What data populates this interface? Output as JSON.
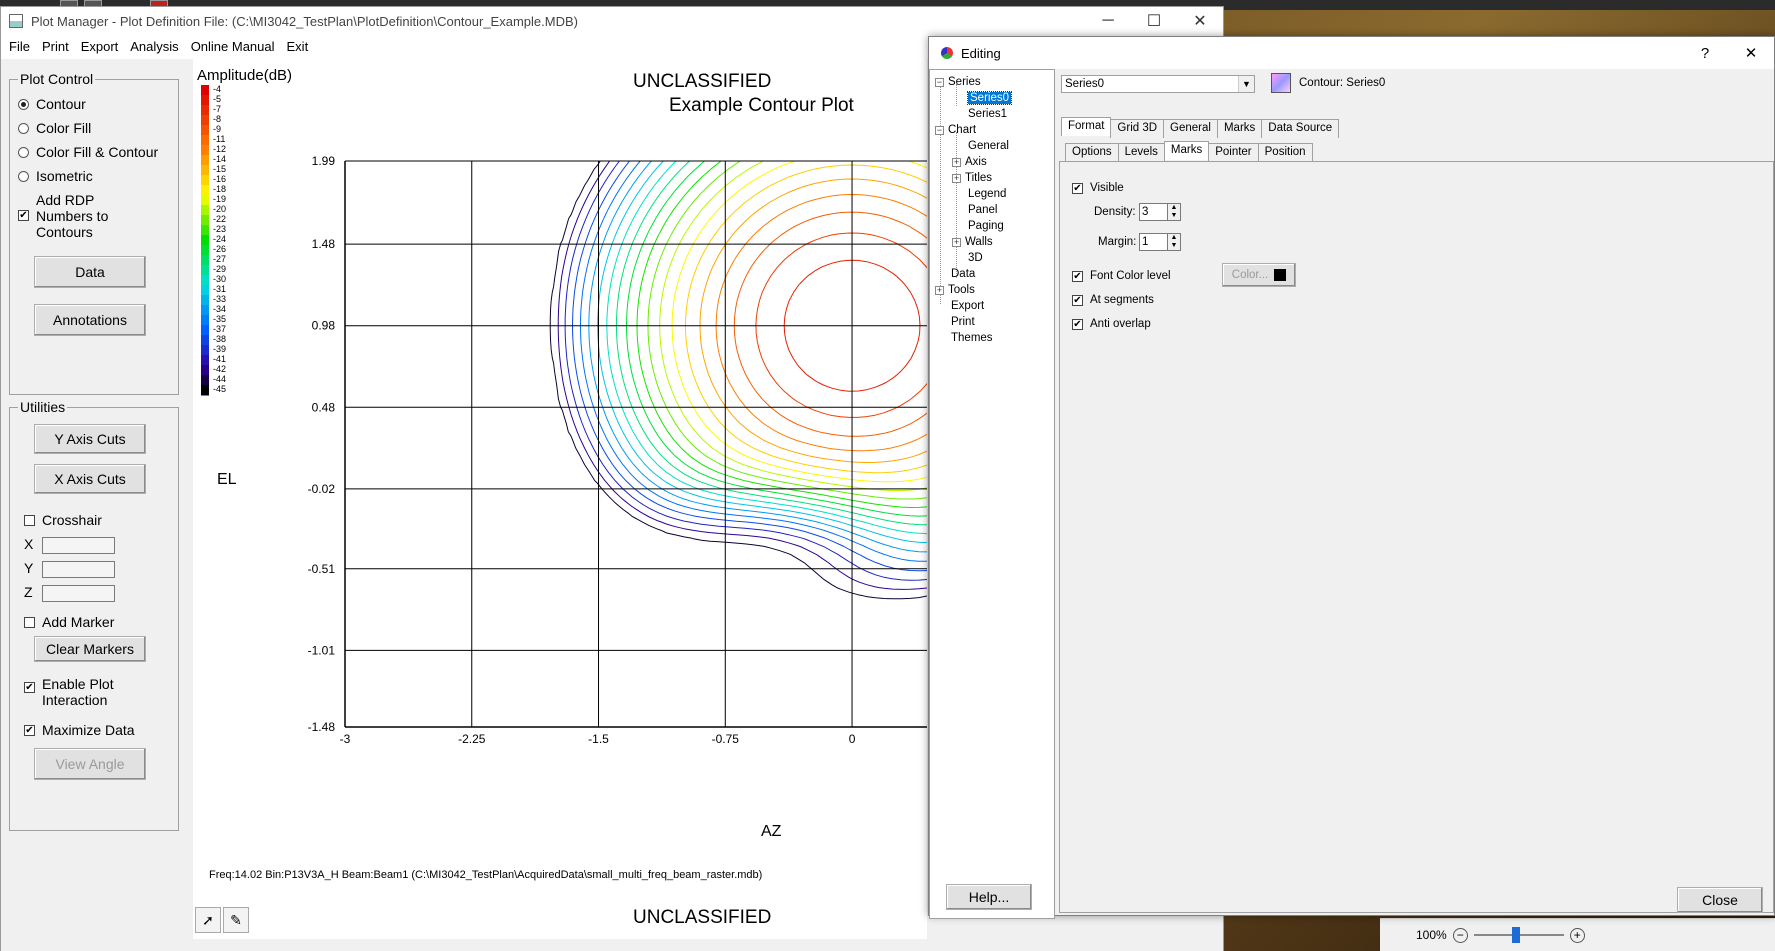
{
  "main_window": {
    "title": "Plot Manager - Plot Definition File: (C:\\MI3042_TestPlan\\PlotDefinition\\Contour_Example.MDB)",
    "minimize": "─",
    "maximize": "☐",
    "close": "✕"
  },
  "menu": [
    "File",
    "Print",
    "Export",
    "Analysis",
    "Online Manual",
    "Exit"
  ],
  "plot_control": {
    "title": "Plot Control",
    "options": [
      "Contour",
      "Color Fill",
      "Color Fill & Contour",
      "Isometric"
    ],
    "selected": "Contour",
    "add_rdp_label_1": "Add RDP",
    "add_rdp_label_2": "Numbers to",
    "add_rdp_label_3": "Contours",
    "add_rdp_checked": "✔",
    "data_button": "Data",
    "annotations_button": "Annotations"
  },
  "utilities": {
    "title": "Utilities",
    "y_axis_cuts": "Y Axis Cuts",
    "x_axis_cuts": "X Axis Cuts",
    "crosshair": "Crosshair",
    "x_label": "X",
    "y_label": "Y",
    "z_label": "Z",
    "add_marker": "Add Marker",
    "clear_markers": "Clear Markers",
    "enable_plot_interaction_1": "Enable Plot",
    "enable_plot_interaction_2": "Interaction",
    "enable_checked": "✔",
    "maximize_data": "Maximize Data",
    "maximize_checked": "✔",
    "view_angle": "View Angle"
  },
  "plot": {
    "classification_top": "UNCLASSIFIED",
    "title": "Example Contour Plot",
    "legend_title": "Amplitude(dB)",
    "legend_levels": [
      "-4",
      "-5",
      "-7",
      "-8",
      "-9",
      "-11",
      "-12",
      "-14",
      "-15",
      "-16",
      "-18",
      "-19",
      "-20",
      "-22",
      "-23",
      "-24",
      "-26",
      "-27",
      "-29",
      "-30",
      "-31",
      "-33",
      "-34",
      "-35",
      "-37",
      "-38",
      "-39",
      "-41",
      "-42",
      "-44",
      "-45"
    ],
    "ylabel": "EL",
    "xlabel": "AZ",
    "footer_info": "Freq:14.02  Bin:P13V3A_H  Beam:Beam1  (C:\\MI3042_TestPlan\\AcquiredData\\small_multi_freq_beam_raster.mdb)",
    "classification_bottom": "UNCLASSIFIED"
  },
  "chart_data": {
    "type": "contour",
    "title": "Example Contour Plot",
    "xlabel": "AZ",
    "ylabel": "EL",
    "colorbar_label": "Amplitude(dB)",
    "x_ticks": [
      -3,
      -2.25,
      -1.5,
      -0.75,
      0
    ],
    "y_ticks": [
      1.99,
      1.48,
      0.98,
      0.48,
      -0.02,
      -0.51,
      -1.01,
      -1.48
    ],
    "x_tick_labels": [
      "-3",
      "-2.25",
      "-1.5",
      "-0.75",
      "0"
    ],
    "y_tick_labels": [
      "1.99",
      "1.48",
      "0.98",
      "0.48",
      "-0.02",
      "-0.51",
      "-1.01",
      "-1.48"
    ],
    "xlim": [
      -3,
      0.55
    ],
    "ylim": [
      -1.48,
      1.99
    ],
    "zlim": [
      -45,
      -4
    ],
    "grid": true,
    "peaks": [
      {
        "az": 0.0,
        "el": 0.98,
        "value": -4
      },
      {
        "az": -2.5,
        "el": 1.0,
        "value": -45
      }
    ]
  },
  "dialog": {
    "title": "Editing",
    "help_q": "?",
    "close_x": "✕",
    "tree": {
      "series": "Series",
      "series0": "Series0",
      "series1": "Series1",
      "chart": "Chart",
      "general": "General",
      "axis": "Axis",
      "titles": "Titles",
      "legend": "Legend",
      "panel": "Panel",
      "paging": "Paging",
      "walls": "Walls",
      "three_d": "3D",
      "data": "Data",
      "tools": "Tools",
      "export": "Export",
      "print": "Print",
      "themes": "Themes"
    },
    "series_select": "Series0",
    "series_caption": "Contour: Series0",
    "tabs_top": [
      "Format",
      "Grid 3D",
      "General",
      "Marks",
      "Data Source"
    ],
    "tabs_sub": [
      "Options",
      "Levels",
      "Marks",
      "Pointer",
      "Position"
    ],
    "marks": {
      "visible": "Visible",
      "density_label": "Density:",
      "density_value": "3",
      "margin_label": "Margin:",
      "margin_value": "1",
      "font_color_level": "Font Color level",
      "color_button": "Color...",
      "at_segments": "At segments",
      "anti_overlap": "Anti overlap",
      "check": "✔"
    },
    "help_button": "Help...",
    "close_button": "Close"
  },
  "statusbar": {
    "zoom": "100%",
    "zoom_out": "−",
    "zoom_in": "+"
  }
}
